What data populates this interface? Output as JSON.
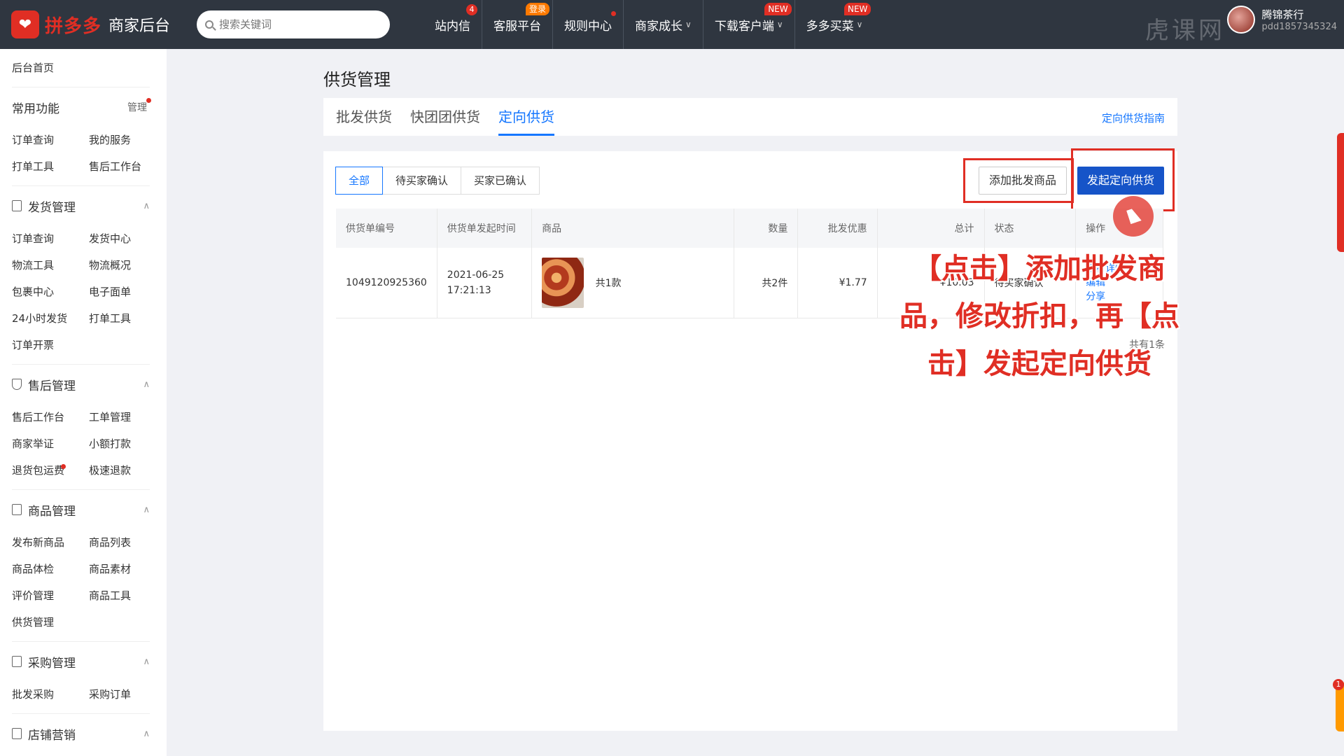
{
  "header": {
    "logo_brand": "拼多多",
    "logo_sub": "商家后台",
    "search_placeholder": "搜索关键词",
    "nav": [
      {
        "label": "站内信",
        "badge": "4"
      },
      {
        "label": "客服平台",
        "tag": "登录"
      },
      {
        "label": "规则中心"
      },
      {
        "label": "商家成长"
      },
      {
        "label": "下载客户端",
        "tag": "NEW"
      },
      {
        "label": "多多买菜",
        "tag": "NEW"
      }
    ],
    "user_name": "腾锦茶行",
    "user_id": "pdd1857345324",
    "watermark": "虎课网"
  },
  "sidebar": {
    "home": "后台首页",
    "common": {
      "title": "常用功能",
      "manage": "管理",
      "items": [
        "订单查询",
        "我的服务",
        "打单工具",
        "售后工作台"
      ]
    },
    "shipping": {
      "title": "发货管理",
      "items": [
        "订单查询",
        "发货中心",
        "物流工具",
        "物流概况",
        "包裹中心",
        "电子面单",
        "24小时发货",
        "打单工具",
        "订单开票"
      ]
    },
    "aftersale": {
      "title": "售后管理",
      "items": [
        "售后工作台",
        "工单管理",
        "商家举证",
        "小额打款",
        "退货包运费",
        "极速退款"
      ]
    },
    "goods": {
      "title": "商品管理",
      "items": [
        "发布新商品",
        "商品列表",
        "商品体检",
        "商品素材",
        "评价管理",
        "商品工具",
        "供货管理"
      ]
    },
    "purchase": {
      "title": "采购管理",
      "items": [
        "批发采购",
        "采购订单"
      ]
    },
    "marketing": {
      "title": "店铺营销"
    }
  },
  "main": {
    "title": "供货管理",
    "tabs": [
      "批发供货",
      "快团团供货",
      "定向供货"
    ],
    "guide": "定向供货指南",
    "filters": [
      "全部",
      "待买家确认",
      "买家已确认"
    ],
    "btn_add": "添加批发商品",
    "btn_launch": "发起定向供货",
    "columns": [
      "供货单编号",
      "供货单发起时间",
      "商品",
      "数量",
      "批发优惠",
      "总计",
      "状态",
      "操作"
    ],
    "rows": [
      {
        "id": "1049120925360",
        "date": "2021-06-25",
        "time": "17:21:13",
        "goods": "共1款",
        "qty": "共2件",
        "discount": "¥1.77",
        "total": "¥10.03",
        "status": "待买家确认",
        "ops": [
          "查看详情",
          "编辑",
          "分享"
        ]
      }
    ],
    "total_text": "共有1条"
  },
  "annotation": "【点击】添加批发商品，修改折扣，再【点击】发起定向供货",
  "side_badge": "1"
}
